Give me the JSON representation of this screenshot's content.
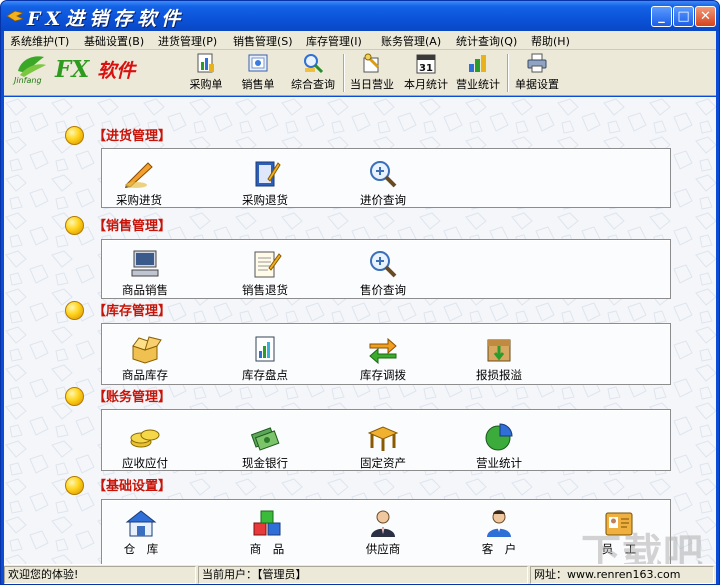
{
  "window": {
    "title": "FX进销存软件"
  },
  "menu": [
    "系统维护(T)",
    "基础设置(B)",
    "进货管理(P)",
    "销售管理(S)",
    "库存管理(I)",
    "账务管理(A)",
    "统计查询(Q)",
    "帮助(H)"
  ],
  "brand": {
    "logo_text": "Jinfang",
    "name_fx": "FX",
    "name_cn": "软件"
  },
  "toolbar": [
    {
      "label": "采购单",
      "icon": "purchase-order-icon"
    },
    {
      "label": "销售单",
      "icon": "sales-order-icon"
    },
    {
      "label": "综合查询",
      "icon": "query-icon"
    },
    {
      "label": "当日营业",
      "icon": "daily-business-icon"
    },
    {
      "label": "本月统计",
      "icon": "calendar-icon",
      "calendar_day": "31"
    },
    {
      "label": "营业统计",
      "icon": "business-stats-icon"
    },
    {
      "label": "单据设置",
      "icon": "printer-icon"
    }
  ],
  "sections": [
    {
      "title": "【进货管理】",
      "items": [
        {
          "label": "采购进货",
          "icon": "pen-icon"
        },
        {
          "label": "采购退货",
          "icon": "book-pen-icon"
        },
        {
          "label": "进价查询",
          "icon": "magnifier-icon"
        }
      ]
    },
    {
      "title": "【销售管理】",
      "items": [
        {
          "label": "商品销售",
          "icon": "computer-icon"
        },
        {
          "label": "销售退货",
          "icon": "notepad-icon"
        },
        {
          "label": "售价查询",
          "icon": "magnifier-icon"
        }
      ]
    },
    {
      "title": "【库存管理】",
      "items": [
        {
          "label": "商品库存",
          "icon": "open-box-icon"
        },
        {
          "label": "库存盘点",
          "icon": "report-icon"
        },
        {
          "label": "库存调拨",
          "icon": "transfer-arrows-icon"
        },
        {
          "label": "报损报溢",
          "icon": "damaged-box-icon"
        }
      ]
    },
    {
      "title": "【账务管理】",
      "items": [
        {
          "label": "应收应付",
          "icon": "coins-icon"
        },
        {
          "label": "现金银行",
          "icon": "cash-icon"
        },
        {
          "label": "固定资产",
          "icon": "table-icon"
        },
        {
          "label": "营业统计",
          "icon": "pie-chart-icon"
        }
      ]
    },
    {
      "title": "【基础设置】",
      "items": [
        {
          "label": "仓　库",
          "icon": "warehouse-icon"
        },
        {
          "label": "商　品",
          "icon": "cubes-icon"
        },
        {
          "label": "供应商",
          "icon": "supplier-icon"
        },
        {
          "label": "客　户",
          "icon": "customer-icon"
        },
        {
          "label": "员　工",
          "icon": "employee-icon"
        }
      ]
    }
  ],
  "watermark": "下载吧",
  "status": {
    "welcome": "欢迎您的体验!",
    "user": "当前用户：【管理员】",
    "site": "网址：www.renren163.com"
  }
}
